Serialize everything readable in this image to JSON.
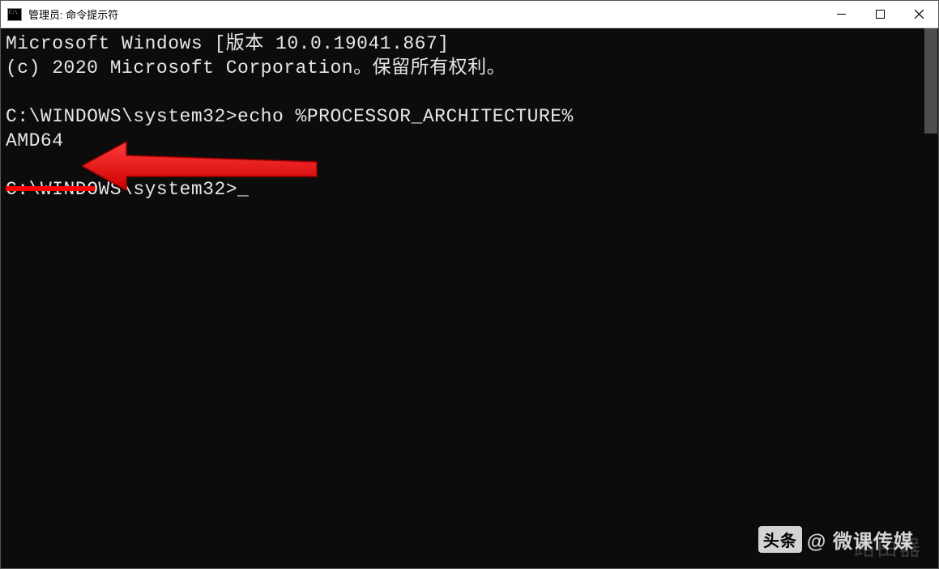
{
  "window": {
    "title": "管理员: 命令提示符"
  },
  "terminal": {
    "line1": "Microsoft Windows [版本 10.0.19041.867]",
    "line2": "(c) 2020 Microsoft Corporation。保留所有权利。",
    "blank1": "",
    "prompt1_path": "C:\\WINDOWS\\system32>",
    "prompt1_cmd": "echo %PROCESSOR_ARCHITECTURE%",
    "output1": "AMD64",
    "blank2": "",
    "prompt2_path": "C:\\WINDOWS\\system32>",
    "cursor": "_"
  },
  "watermark": {
    "badge": "头条",
    "text": "@ 微课传媒",
    "faint": "路由器"
  }
}
